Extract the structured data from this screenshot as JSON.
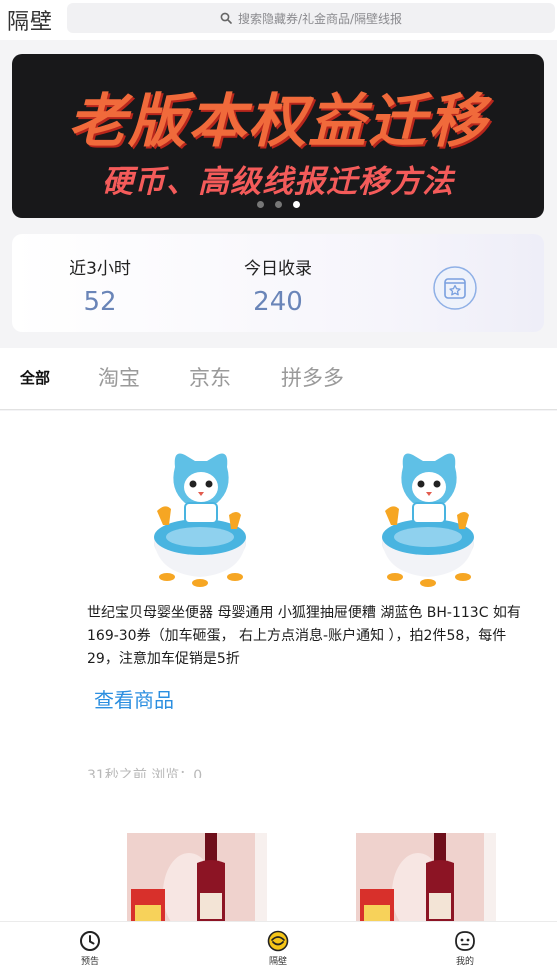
{
  "header": {
    "app_title": "隔壁",
    "search_placeholder": "搜索隐藏券/礼金商品/隔壁线报",
    "search_icon": "search-icon"
  },
  "banner": {
    "title": "老版本权益迁移",
    "subtitle": "硬币、高级线报迁移方法",
    "slide_count": 3,
    "active_slide": 3,
    "colors": {
      "background": "#18181a",
      "title": "#f06a3b",
      "subtitle": "#f45b5a"
    }
  },
  "stats": {
    "recent_label": "近3小时",
    "recent_value": "52",
    "today_label": "今日收录",
    "today_value": "240",
    "icon": "starred-folder-icon"
  },
  "tabs": [
    {
      "label": "全部",
      "active": true
    },
    {
      "label": "淘宝",
      "active": false
    },
    {
      "label": "京东",
      "active": false
    },
    {
      "label": "拼多多",
      "active": false
    }
  ],
  "feed": {
    "item": {
      "description": "世纪宝贝母婴坐便器 母婴通用 小狐狸抽屉便糟 湖蓝色 BH-113C 如有169-30券（加车砸蛋， 右上方点消息-账户通知 ），拍2件58，每件29，注意加车促销是5折",
      "view_link": "查看商品",
      "meta": "31秒之前 浏览：0"
    }
  },
  "bottom_nav": [
    {
      "label": "预告",
      "icon": "clock-icon"
    },
    {
      "label": "隔壁",
      "icon": "home-face-icon",
      "active": true
    },
    {
      "label": "我的",
      "icon": "profile-face-icon"
    }
  ],
  "colors": {
    "accent_blue": "#2c8fe0",
    "stat_value": "#6a85b8",
    "nav_active": "#f5c518"
  }
}
